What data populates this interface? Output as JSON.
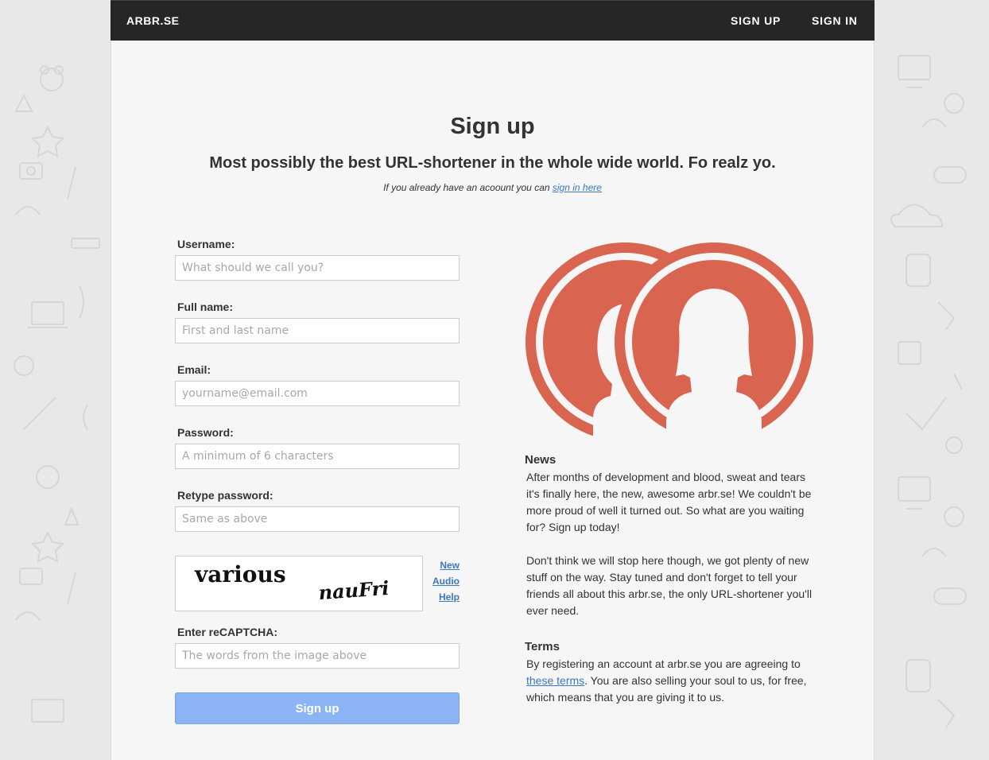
{
  "nav": {
    "brand": "ARBR.SE",
    "signup": "SIGN UP",
    "signin": "SIGN IN"
  },
  "header": {
    "title": "Sign up",
    "subtitle": "Most possibly the best URL-shortener in the whole wide world. Fo realz yo.",
    "signin_note_prefix": "If you already have an acoount you can",
    "signin_link": "sign in here"
  },
  "form": {
    "username": {
      "label": "Username:",
      "placeholder": "What should we call you?"
    },
    "fullname": {
      "label": "Full name:",
      "placeholder": "First and last name"
    },
    "email": {
      "label": "Email:",
      "placeholder": "yourname@email.com"
    },
    "password": {
      "label": "Password:",
      "placeholder": "A minimum of 6 characters"
    },
    "retype": {
      "label": "Retype password:",
      "placeholder": "Same as above"
    },
    "captcha": {
      "word1": "various",
      "word2": "nauFri",
      "links": [
        "New",
        "Audio",
        "Help"
      ],
      "label": "Enter reCAPTCHA:",
      "placeholder": "The words from the image above"
    },
    "submit": "Sign up"
  },
  "news": {
    "title": "News",
    "p1": "After months of development and blood, sweat and tears it's finally here, the new, awesome arbr.se! We couldn't be more proud of well it turned out. So what are you waiting for? Sign up today!",
    "p2": "Don't think we will stop here though, we got plenty of new stuff on the way. Stay tuned and don't forget to tell your friends all about this arbr.se, the only URL-shortener you'll ever need."
  },
  "terms": {
    "title": "Terms",
    "before": "By registering an account at arbr.se you are agreeing to",
    "link": "these terms",
    "after": ". You are also selling your soul to us, for free, which means that you are giving it to us."
  },
  "colors": {
    "topbar": "#262626",
    "accent_red": "#d96550",
    "link": "#3a78c3",
    "button": "#8ab4f5"
  }
}
